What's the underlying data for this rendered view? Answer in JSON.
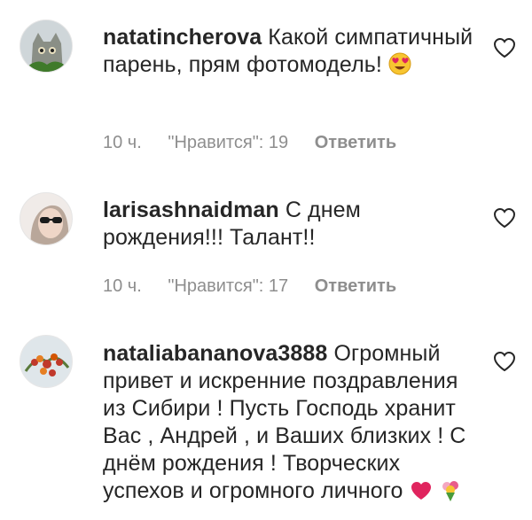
{
  "comments": [
    {
      "username": "natatincherova",
      "text": " Какой симпатичный парень, прям фотомодель! ",
      "emoji": "smiling-heart-eyes-emoji",
      "time": "10 ч.",
      "likes": "\"Нравится\": 19",
      "reply": "Ответить"
    },
    {
      "username": "larisashnaidman",
      "text": " С днем рождения!!! Талант!!",
      "time": "10 ч.",
      "likes": "\"Нравится\": 17",
      "reply": "Ответить"
    },
    {
      "username": "nataliabananova3888",
      "text": " Огромный привет и искренние поздравления из Сибири ! Пусть Господь хранит Вас , Андрей , и Ваших близких ! С днём рождения ! Творческих успехов и огромного личного"
    }
  ],
  "icons": {
    "like": "heart-outline-icon"
  }
}
